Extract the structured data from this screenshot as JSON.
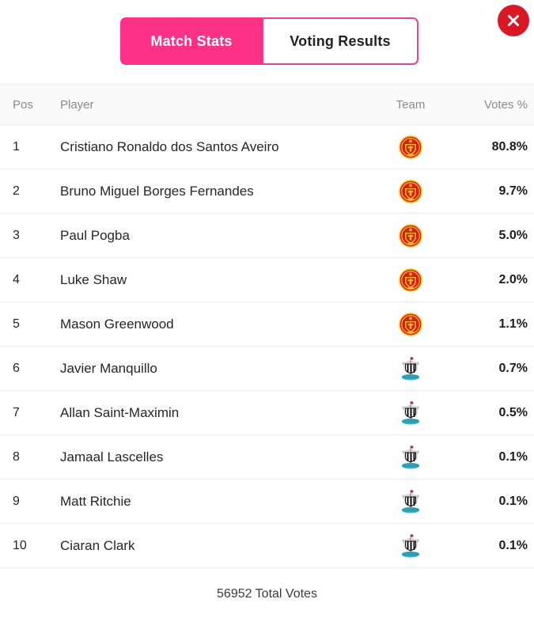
{
  "window": {
    "close_label": "×",
    "close_icon": "close-circle-icon",
    "accent_pink": "#fb3186",
    "close_red": "#d81925"
  },
  "tabs": [
    {
      "label": "Match Stats",
      "active": false
    },
    {
      "label": "Voting Results",
      "active": true
    }
  ],
  "table": {
    "headers": {
      "pos": "Pos",
      "player": "Player",
      "team": "Team",
      "votes": "Votes %"
    },
    "rows": [
      {
        "pos": "1",
        "player": "Cristiano Ronaldo dos Santos Aveiro",
        "team": "manchester-united",
        "team_name": "Manchester United",
        "votes": "80.8%"
      },
      {
        "pos": "2",
        "player": "Bruno Miguel Borges Fernandes",
        "team": "manchester-united",
        "team_name": "Manchester United",
        "votes": "9.7%"
      },
      {
        "pos": "3",
        "player": "Paul Pogba",
        "team": "manchester-united",
        "team_name": "Manchester United",
        "votes": "5.0%"
      },
      {
        "pos": "4",
        "player": "Luke Shaw",
        "team": "manchester-united",
        "team_name": "Manchester United",
        "votes": "2.0%"
      },
      {
        "pos": "5",
        "player": "Mason Greenwood",
        "team": "manchester-united",
        "team_name": "Manchester United",
        "votes": "1.1%"
      },
      {
        "pos": "6",
        "player": "Javier Manquillo",
        "team": "newcastle-united",
        "team_name": "Newcastle United",
        "votes": "0.7%"
      },
      {
        "pos": "7",
        "player": "Allan Saint-Maximin",
        "team": "newcastle-united",
        "team_name": "Newcastle United",
        "votes": "0.5%"
      },
      {
        "pos": "8",
        "player": "Jamaal Lascelles",
        "team": "newcastle-united",
        "team_name": "Newcastle United",
        "votes": "0.1%"
      },
      {
        "pos": "9",
        "player": "Matt Ritchie",
        "team": "newcastle-united",
        "team_name": "Newcastle United",
        "votes": "0.1%"
      },
      {
        "pos": "10",
        "player": "Ciaran Clark",
        "team": "newcastle-united",
        "team_name": "Newcastle United",
        "votes": "0.1%"
      }
    ]
  },
  "footer": {
    "total_votes": "56952 Total Votes"
  },
  "chart_data": {
    "type": "bar",
    "title": "Voting Results",
    "xlabel": "Player",
    "ylabel": "Votes %",
    "categories": [
      "Cristiano Ronaldo dos Santos Aveiro",
      "Bruno Miguel Borges Fernandes",
      "Paul Pogba",
      "Luke Shaw",
      "Mason Greenwood",
      "Javier Manquillo",
      "Allan Saint-Maximin",
      "Jamaal Lascelles",
      "Matt Ritchie",
      "Ciaran Clark"
    ],
    "values": [
      80.8,
      9.7,
      5.0,
      2.0,
      1.1,
      0.7,
      0.5,
      0.1,
      0.1,
      0.1
    ],
    "ylim": [
      0,
      100
    ],
    "total_votes": 56952
  }
}
